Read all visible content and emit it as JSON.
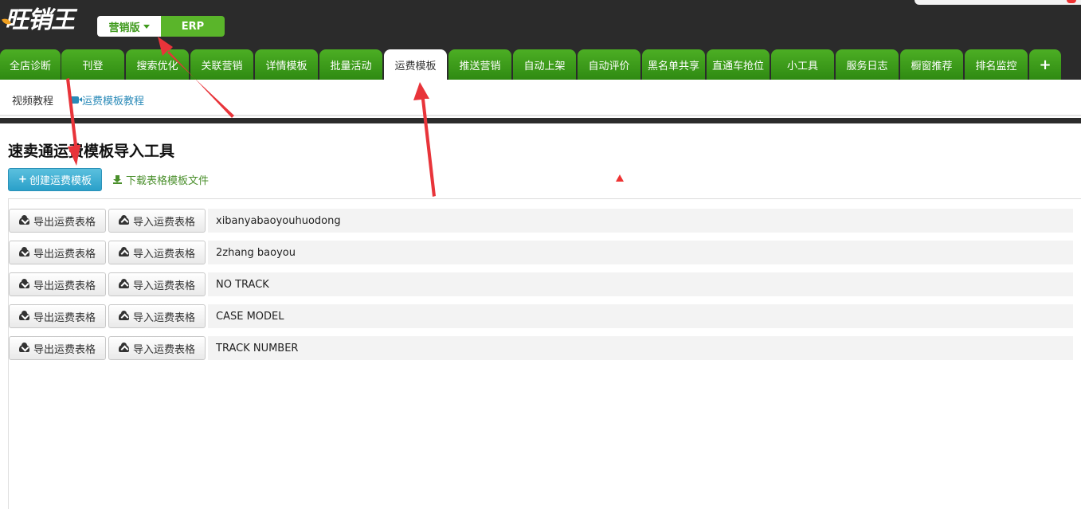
{
  "header": {
    "logo_text": "旺销王",
    "version_active": "营销版",
    "version_other": "ERP"
  },
  "nav": {
    "tabs": [
      {
        "label": "全店诊断"
      },
      {
        "label": "刊登"
      },
      {
        "label": "搜索优化"
      },
      {
        "label": "关联营销"
      },
      {
        "label": "详情模板"
      },
      {
        "label": "批量活动"
      },
      {
        "label": "运费模板",
        "active": true
      },
      {
        "label": "推送营销"
      },
      {
        "label": "自动上架"
      },
      {
        "label": "自动评价"
      },
      {
        "label": "黑名单共享"
      },
      {
        "label": "直通车抢位"
      },
      {
        "label": "小工具"
      },
      {
        "label": "服务日志"
      },
      {
        "label": "橱窗推荐"
      },
      {
        "label": "排名监控"
      }
    ],
    "plus_label": "+"
  },
  "subbar": {
    "video_label": "视频教程",
    "tutorial_link": "运费模板教程"
  },
  "main": {
    "title": "速卖通运费模板导入工具",
    "create_button": "创建运费模板",
    "download_link": "下载表格模板文件",
    "export_label": "导出运费表格",
    "import_label": "导入运费表格",
    "templates": [
      {
        "name": "xibanyabaoyouhuodong"
      },
      {
        "name": "2zhang baoyou"
      },
      {
        "name": "NO TRACK"
      },
      {
        "name": "CASE MODEL"
      },
      {
        "name": "TRACK NUMBER"
      }
    ]
  },
  "colors": {
    "nav_green": "#3f9a1c",
    "header_dark": "#2b2b2b",
    "primary_blue": "#2aa0c9",
    "annotation_red": "#e33333"
  },
  "icons": [
    "video-icon",
    "plus-icon",
    "download-icon",
    "cloud-upload-icon",
    "cloud-download-icon",
    "caret-down-icon"
  ]
}
